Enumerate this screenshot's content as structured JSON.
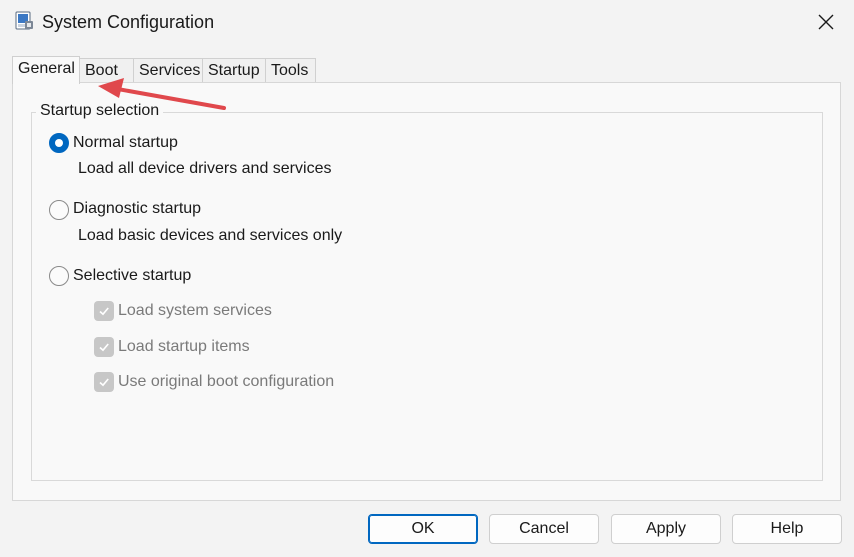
{
  "window": {
    "title": "System Configuration",
    "icon": "msconfig-icon"
  },
  "tabs": [
    {
      "label": "General"
    },
    {
      "label": "Boot"
    },
    {
      "label": "Services"
    },
    {
      "label": "Startup"
    },
    {
      "label": "Tools"
    }
  ],
  "active_tab": "General",
  "group": {
    "label": "Startup selection"
  },
  "options": {
    "normal": {
      "label": "Normal startup",
      "desc": "Load all device drivers and services",
      "selected": true
    },
    "diagnostic": {
      "label": "Diagnostic startup",
      "desc": "Load basic devices and services only",
      "selected": false
    },
    "selective": {
      "label": "Selective startup",
      "selected": false
    }
  },
  "checks": [
    {
      "label": "Load system services",
      "checked": true,
      "enabled": false
    },
    {
      "label": "Load startup items",
      "checked": true,
      "enabled": false
    },
    {
      "label": "Use original boot configuration",
      "checked": true,
      "enabled": false
    }
  ],
  "buttons": {
    "ok": "OK",
    "cancel": "Cancel",
    "apply": "Apply",
    "help": "Help"
  },
  "colors": {
    "accent": "#0067c0",
    "annotation_arrow": "#e0484c"
  }
}
